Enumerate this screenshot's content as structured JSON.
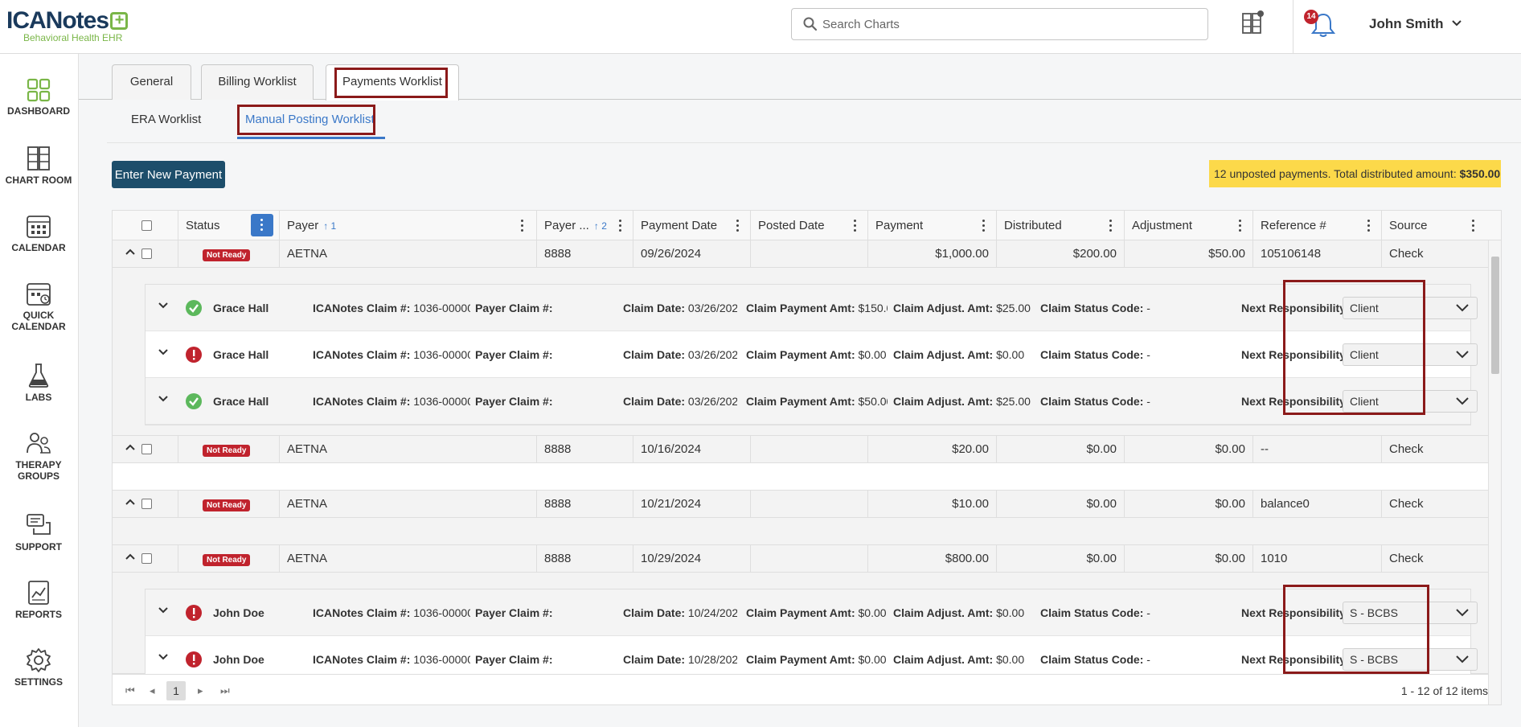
{
  "app": {
    "logo_text_a": "ICA",
    "logo_text_b": "Notes",
    "logo_sub": "Behavioral Health EHR"
  },
  "header": {
    "search_placeholder": "Search Charts",
    "notification_count": "14",
    "user_name": "John Smith"
  },
  "sidebar": {
    "items": [
      {
        "label": "DASHBOARD",
        "icon": "dashboard-icon"
      },
      {
        "label": "CHART ROOM",
        "icon": "chart-room-icon"
      },
      {
        "label": "CALENDAR",
        "icon": "calendar-icon"
      },
      {
        "label_1": "QUICK",
        "label_2": "CALENDAR",
        "icon": "quick-calendar-icon"
      },
      {
        "label": "LABS",
        "icon": "flask-icon"
      },
      {
        "label_1": "THERAPY",
        "label_2": "GROUPS",
        "icon": "therapy-groups-icon"
      },
      {
        "label": "SUPPORT",
        "icon": "support-icon"
      },
      {
        "label": "REPORTS",
        "icon": "reports-icon"
      },
      {
        "label": "SETTINGS",
        "icon": "gear-icon"
      }
    ]
  },
  "tabs": [
    {
      "label": "General"
    },
    {
      "label": "Billing Worklist"
    },
    {
      "label": "Payments Worklist"
    }
  ],
  "subtabs": [
    {
      "label": "ERA Worklist"
    },
    {
      "label": "Manual Posting Worklist"
    }
  ],
  "toolbar": {
    "enter_payment_label": "Enter New Payment",
    "summary_text": "12 unposted payments. Total distributed amount: ",
    "summary_amount": "$350.00"
  },
  "grid": {
    "columns": [
      {
        "label": "Status"
      },
      {
        "label": "Payer",
        "sort": "↑ 1"
      },
      {
        "label": "Payer ...",
        "sort": "↑ 2"
      },
      {
        "label": "Payment Date"
      },
      {
        "label": "Posted Date"
      },
      {
        "label": "Payment"
      },
      {
        "label": "Distributed"
      },
      {
        "label": "Adjustment"
      },
      {
        "label": "Reference #"
      },
      {
        "label": "Source"
      }
    ],
    "rows": [
      {
        "status": "Not Ready",
        "payer": "AETNA",
        "payer_id": "8888",
        "payment_date": "09/26/2024",
        "posted_date": "",
        "payment": "$1,000.00",
        "distributed": "$200.00",
        "adjustment": "$50.00",
        "reference": "105106148",
        "source": "Check"
      },
      {
        "status": "Not Ready",
        "payer": "AETNA",
        "payer_id": "8888",
        "payment_date": "10/16/2024",
        "posted_date": "",
        "payment": "$20.00",
        "distributed": "$0.00",
        "adjustment": "$0.00",
        "reference": "--",
        "source": "Check"
      },
      {
        "status": "Not Ready",
        "payer": "AETNA",
        "payer_id": "8888",
        "payment_date": "10/21/2024",
        "posted_date": "",
        "payment": "$10.00",
        "distributed": "$0.00",
        "adjustment": "$0.00",
        "reference": "balance0",
        "source": "Check"
      },
      {
        "status": "Not Ready",
        "payer": "AETNA",
        "payer_id": "8888",
        "payment_date": "10/29/2024",
        "posted_date": "",
        "payment": "$800.00",
        "distributed": "$0.00",
        "adjustment": "$0.00",
        "reference": "1010",
        "source": "Check"
      }
    ],
    "claim_labels": {
      "ica_claim": "ICANotes Claim #:",
      "payer_claim": "Payer Claim #:",
      "claim_date": "Claim Date:",
      "claim_payment": "Claim Payment Amt:",
      "claim_adjust": "Claim Adjust. Amt:",
      "claim_status": "Claim Status Code:",
      "next_resp": "Next Responsibility:"
    },
    "claims_group1": [
      {
        "status_icon": "check-circle-icon",
        "name": "Grace Hall",
        "ica_claim": "1036-00000",
        "claim_date": "03/26/202",
        "claim_payment": "$150.0",
        "claim_adjust": "$25.00",
        "claim_status": "-",
        "next_resp": "Client"
      },
      {
        "status_icon": "error-circle-icon",
        "name": "Grace Hall",
        "ica_claim": "1036-00000",
        "claim_date": "03/26/202",
        "claim_payment": "$0.00",
        "claim_adjust": "$0.00",
        "claim_status": "-",
        "next_resp": "Client"
      },
      {
        "status_icon": "check-circle-icon",
        "name": "Grace Hall",
        "ica_claim": "1036-00000",
        "claim_date": "03/26/202",
        "claim_payment": "$50.00",
        "claim_adjust": "$25.00",
        "claim_status": "-",
        "next_resp": "Client"
      }
    ],
    "claims_group4": [
      {
        "status_icon": "error-circle-icon",
        "name": "John Doe",
        "ica_claim": "1036-00000",
        "claim_date": "10/24/202",
        "claim_payment": "$0.00",
        "claim_adjust": "$0.00",
        "claim_status": "-",
        "next_resp": "S - BCBS"
      },
      {
        "status_icon": "error-circle-icon",
        "name": "John Doe",
        "ica_claim": "1036-00000",
        "claim_date": "10/28/202",
        "claim_payment": "$0.00",
        "claim_adjust": "$0.00",
        "claim_status": "-",
        "next_resp": "S - BCBS"
      }
    ]
  },
  "pager": {
    "current_page": "1",
    "info": "1 - 12 of 12 items"
  },
  "colors": {
    "accent": "#1d4e6b",
    "active_tab_line": "#3a78c8",
    "highlight_box": "#8b1a1a",
    "not_ready": "#c0232d",
    "success": "#5cb85c",
    "summary_bg": "#fcd94a"
  }
}
